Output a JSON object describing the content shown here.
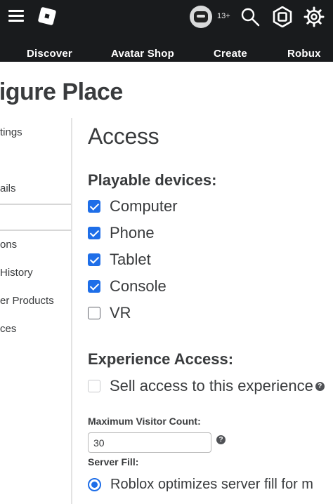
{
  "header": {
    "age_badge": "13+",
    "icons": [
      "menu-icon",
      "roblox-logo-icon",
      "avatar",
      "search-icon",
      "robux-icon",
      "gear-icon"
    ]
  },
  "nav": {
    "items": [
      "Discover",
      "Avatar Shop",
      "Create",
      "Robux"
    ]
  },
  "page_title": "figure Place",
  "sidebar": {
    "items": [
      "tings",
      "ails",
      "",
      "ons",
      "History",
      "er Products",
      "ces"
    ]
  },
  "main": {
    "section_title": "Access",
    "playable_devices": {
      "heading": "Playable devices:",
      "options": [
        {
          "label": "Computer",
          "checked": true
        },
        {
          "label": "Phone",
          "checked": true
        },
        {
          "label": "Tablet",
          "checked": true
        },
        {
          "label": "Console",
          "checked": true
        },
        {
          "label": "VR",
          "checked": false
        }
      ]
    },
    "experience_access": {
      "heading": "Experience Access:",
      "sell_access_label": "Sell access to this experience",
      "sell_access_checked": false
    },
    "max_visitor": {
      "label": "Maximum Visitor Count:",
      "value": "30"
    },
    "server_fill": {
      "label": "Server Fill:",
      "selected_option": "Roblox optimizes server fill for m"
    }
  },
  "colors": {
    "topbar": "#191b1d",
    "accent_blue": "#1e6ee8",
    "text": "#393b3d"
  }
}
